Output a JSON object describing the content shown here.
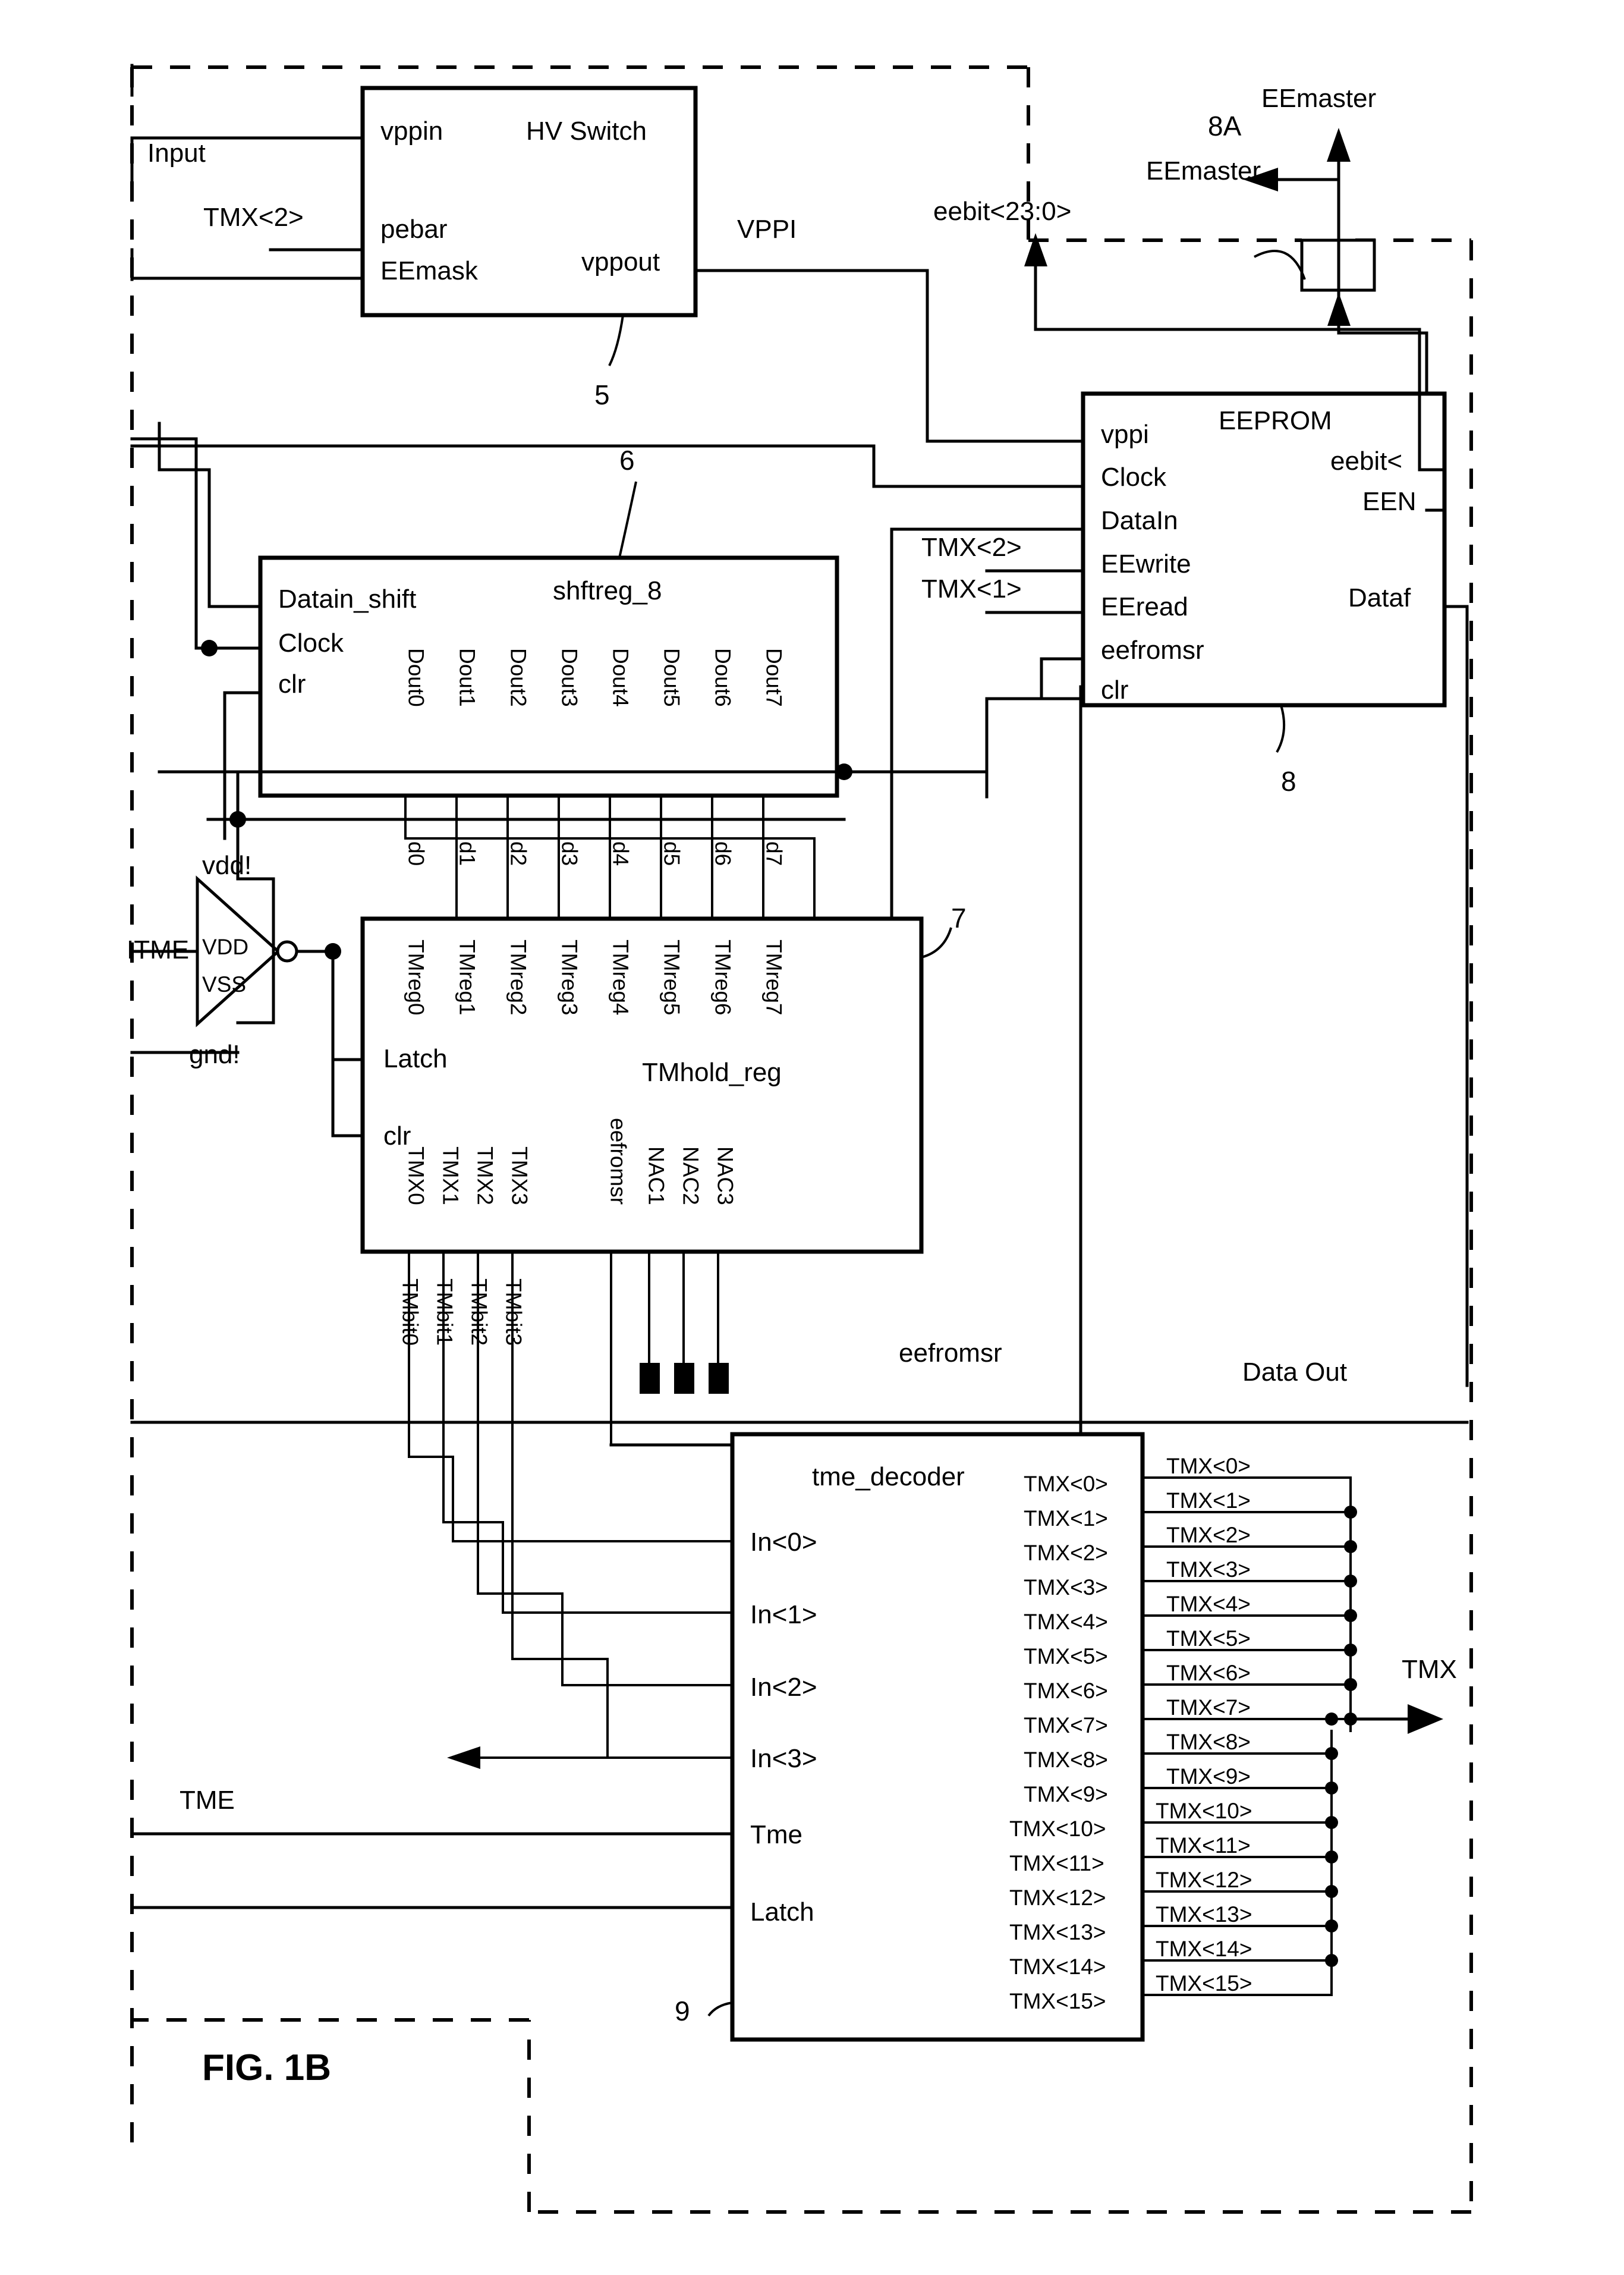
{
  "figure": {
    "label": "FIG. 1B",
    "reference_numerals": [
      "5",
      "6",
      "7",
      "8",
      "8A",
      "9"
    ]
  },
  "blocks": {
    "hv_switch": {
      "title": "HV Switch",
      "ref": "5",
      "inputs": [
        "vppin",
        "pebar",
        "EEmask"
      ],
      "outputs": [
        "vppout"
      ]
    },
    "eeprom": {
      "title": "EEPROM",
      "ref": "8",
      "inputs": [
        "vppi",
        "Clock",
        "DataIn",
        "EEwrite",
        "EEread",
        "eefromsr",
        "clr"
      ],
      "outputs": [
        "eebit<",
        "EEN",
        "Dataf"
      ]
    },
    "shftreg": {
      "title": "shftreg_8",
      "ref": "6",
      "inputs": [
        "Datain_shift",
        "Clock",
        "clr"
      ],
      "outputs": [
        "Dout0",
        "Dout1",
        "Dout2",
        "Dout3",
        "Dout4",
        "Dout5",
        "Dout6",
        "Dout7"
      ]
    },
    "tmhold_reg": {
      "title": "TMhold_reg",
      "ref": "7",
      "top_inputs": [
        "TMreg0",
        "TMreg1",
        "TMreg2",
        "TMreg3",
        "TMreg4",
        "TMreg5",
        "TMreg6",
        "TMreg7"
      ],
      "side_inputs": [
        "Latch",
        "clr"
      ],
      "bottom_outputs": [
        "TMX0",
        "TMX1",
        "TMX2",
        "TMX3",
        "eefromsr",
        "NAC1",
        "NAC2",
        "NAC3"
      ]
    },
    "tme_decoder": {
      "title": "tme_decoder",
      "ref": "9",
      "inputs": [
        "In<0>",
        "In<1>",
        "In<2>",
        "In<3>",
        "Tme",
        "Latch"
      ],
      "outputs": [
        "TMX<0>",
        "TMX<1>",
        "TMX<2>",
        "TMX<3>",
        "TMX<4>",
        "TMX<5>",
        "TMX<6>",
        "TMX<7>",
        "TMX<8>",
        "TMX<9>",
        "TMX<10>",
        "TMX<11>",
        "TMX<12>",
        "TMX<13>",
        "TMX<14>",
        "TMX<15>"
      ]
    },
    "inverter": {
      "input_label": "ITME",
      "supply_top": "vdd!",
      "supply_bottom": "gnd!",
      "pin_top": "VDD",
      "pin_bottom": "VSS"
    },
    "eemaster_pad": {
      "ref": "8A",
      "label_top": "EEmaster",
      "label_side": "EEmaster"
    }
  },
  "nets": {
    "input": "Input",
    "tmx2_hv": "TMX<2>",
    "vppi": "VPPI",
    "eebit23": "eebit<23:0>",
    "tmx2_eeprom": "TMX<2>",
    "tmx1_eeprom": "TMX<1>",
    "data_out": "Data Out",
    "eefromsr": "eefromsr",
    "tme": "TME",
    "tmx_bus": "TMX",
    "d_labels": [
      "d0",
      "d1",
      "d2",
      "d3",
      "d4",
      "d5",
      "d6",
      "d7"
    ],
    "tmbit_labels": [
      "TMbit0",
      "TMbit1",
      "TMbit2",
      "TMbit3"
    ],
    "tmx_out_labels": [
      "TMX<0>",
      "TMX<1>",
      "TMX<2>",
      "TMX<3>",
      "TMX<4>",
      "TMX<5>",
      "TMX<6>",
      "TMX<7>",
      "TMX<8>",
      "TMX<9>",
      "TMX<10>",
      "TMX<11>",
      "TMX<12>",
      "TMX<13>",
      "TMX<14>",
      "TMX<15>"
    ]
  },
  "colors": {
    "ink": "#000000",
    "paper": "#ffffff"
  }
}
